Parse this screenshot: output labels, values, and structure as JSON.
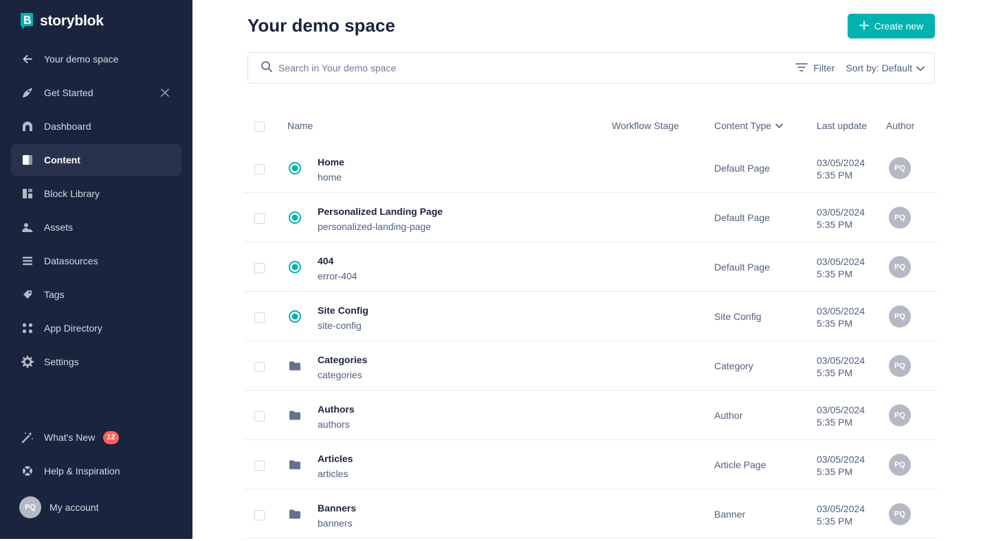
{
  "brand": {
    "name": "storyblok"
  },
  "sidebar": {
    "back_label": "Your demo space",
    "items": [
      {
        "label": "Get Started",
        "icon": "rocket-icon"
      },
      {
        "label": "Dashboard",
        "icon": "dashboard-icon"
      },
      {
        "label": "Content",
        "icon": "content-icon",
        "active": true
      },
      {
        "label": "Block Library",
        "icon": "block-library-icon"
      },
      {
        "label": "Assets",
        "icon": "assets-icon"
      },
      {
        "label": "Datasources",
        "icon": "datasources-icon"
      },
      {
        "label": "Tags",
        "icon": "tag-icon"
      },
      {
        "label": "App Directory",
        "icon": "app-directory-icon"
      },
      {
        "label": "Settings",
        "icon": "gear-icon"
      }
    ],
    "whats_new": {
      "label": "What's New",
      "badge": "12"
    },
    "help_label": "Help & Inspiration",
    "account": {
      "label": "My account",
      "initials": "PQ"
    }
  },
  "header": {
    "title": "Your demo space",
    "create_label": "Create new"
  },
  "search": {
    "placeholder": "Search in Your demo space",
    "filter_label": "Filter",
    "sort_label": "Sort by: Default"
  },
  "table": {
    "columns": {
      "name": "Name",
      "workflow": "Workflow Stage",
      "content_type": "Content Type",
      "last_update": "Last update",
      "author": "Author"
    },
    "rows": [
      {
        "name": "Home",
        "slug": "home",
        "kind": "story",
        "content_type": "Default Page",
        "date": "03/05/2024",
        "time": "5:35 PM",
        "author": "PQ"
      },
      {
        "name": "Personalized Landing Page",
        "slug": "personalized-landing-page",
        "kind": "story",
        "content_type": "Default Page",
        "date": "03/05/2024",
        "time": "5:35 PM",
        "author": "PQ"
      },
      {
        "name": "404",
        "slug": "error-404",
        "kind": "story",
        "content_type": "Default Page",
        "date": "03/05/2024",
        "time": "5:35 PM",
        "author": "PQ"
      },
      {
        "name": "Site Config",
        "slug": "site-config",
        "kind": "story",
        "content_type": "Site Config",
        "date": "03/05/2024",
        "time": "5:35 PM",
        "author": "PQ"
      },
      {
        "name": "Categories",
        "slug": "categories",
        "kind": "folder",
        "content_type": "Category",
        "date": "03/05/2024",
        "time": "5:35 PM",
        "author": "PQ"
      },
      {
        "name": "Authors",
        "slug": "authors",
        "kind": "folder",
        "content_type": "Author",
        "date": "03/05/2024",
        "time": "5:35 PM",
        "author": "PQ"
      },
      {
        "name": "Articles",
        "slug": "articles",
        "kind": "folder",
        "content_type": "Article Page",
        "date": "03/05/2024",
        "time": "5:35 PM",
        "author": "PQ"
      },
      {
        "name": "Banners",
        "slug": "banners",
        "kind": "folder",
        "content_type": "Banner",
        "date": "03/05/2024",
        "time": "5:35 PM",
        "author": "PQ"
      }
    ]
  },
  "colors": {
    "sidebar_bg": "#1b243f",
    "accent": "#00b3b0",
    "badge": "#ff6159"
  }
}
